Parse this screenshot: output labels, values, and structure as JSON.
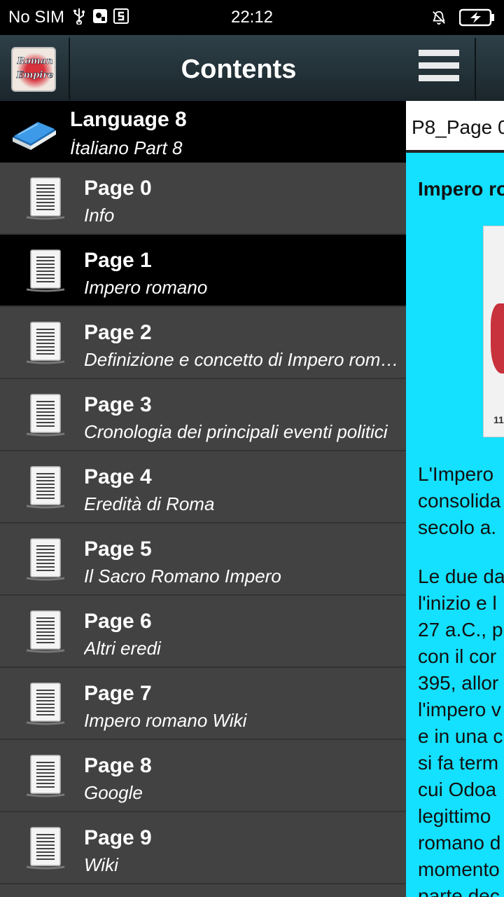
{
  "status_bar": {
    "carrier": "No SIM",
    "time": "22:12"
  },
  "drawer": {
    "title": "Contents",
    "logo_line1": "Roman",
    "logo_line2": "Empire",
    "language_header": {
      "title": "Language 8",
      "subtitle": "İtaliano Part 8"
    },
    "items": [
      {
        "title": "Page 0",
        "subtitle": "Info"
      },
      {
        "title": "Page 1",
        "subtitle": "Impero romano"
      },
      {
        "title": "Page 2",
        "subtitle": "Definizione e concetto di Impero romano"
      },
      {
        "title": "Page 3",
        "subtitle": "Cronologia dei principali eventi politici"
      },
      {
        "title": "Page 4",
        "subtitle": "Eredità di Roma"
      },
      {
        "title": "Page 5",
        "subtitle": "Il Sacro Romano Impero"
      },
      {
        "title": "Page 6",
        "subtitle": "Altri eredi"
      },
      {
        "title": "Page 7",
        "subtitle": "Impero romano Wiki"
      },
      {
        "title": "Page 8",
        "subtitle": "Google"
      },
      {
        "title": "Page 9",
        "subtitle": "Wiki"
      }
    ],
    "selected_index": 1
  },
  "content": {
    "page_header": "P8_Page 0",
    "article_title": "Impero ro",
    "map_caption": "11",
    "paragraph1": [
      "L'Impero",
      "consolida",
      "secolo a."
    ],
    "paragraph2": [
      "Le due da",
      "l'inizio e l",
      "27 a.C., p",
      "con il cor",
      "395, allor",
      "l'impero v",
      "e in una c",
      "si fa term",
      "cui Odoa",
      "legittimo",
      "romano d",
      "momento",
      "parte dec"
    ]
  }
}
